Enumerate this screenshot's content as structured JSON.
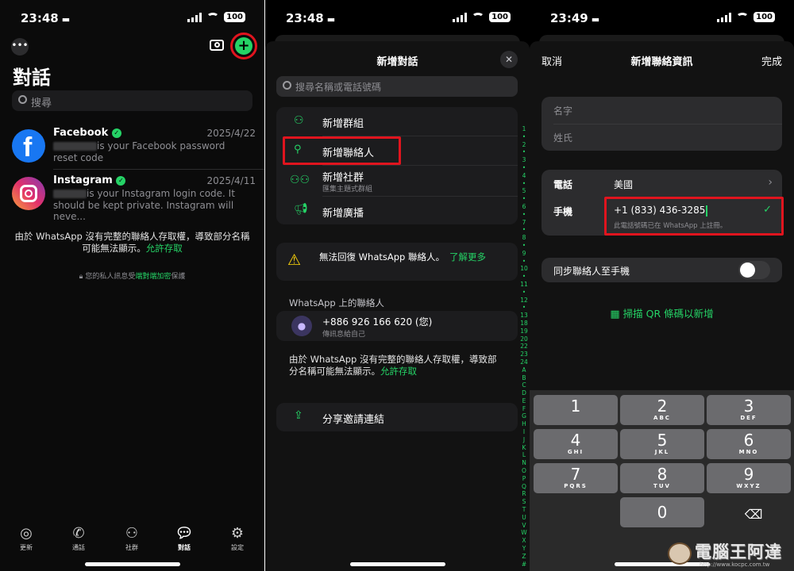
{
  "panel1": {
    "status": {
      "time": "23:48",
      "battery": "100"
    },
    "title": "對話",
    "search_placeholder": "搜尋",
    "chats": [
      {
        "name": "Facebook",
        "date": "2025/4/22",
        "line1": "is your Facebook password",
        "line2": "reset code"
      },
      {
        "name": "Instagram",
        "date": "2025/4/11",
        "line1": "is your Instagram login code. It",
        "line2": "should be kept private. Instagram will neve..."
      }
    ],
    "notice": "由於 WhatsApp 沒有完整的聯絡人存取權，導致部分名稱可能無法顯示。",
    "notice_link": "允許存取",
    "privacy_prefix": "您的私人訊息受",
    "privacy_link": "端對端加密",
    "privacy_suffix": "保護",
    "tabs": [
      "更新",
      "通話",
      "社群",
      "對話",
      "設定"
    ]
  },
  "panel2": {
    "status": {
      "time": "23:48",
      "battery": "100"
    },
    "title": "新增對話",
    "search_placeholder": "搜尋名稱或電話號碼",
    "menu": [
      {
        "label": "新增群組",
        "sub": ""
      },
      {
        "label": "新增聯絡人",
        "sub": ""
      },
      {
        "label": "新增社群",
        "sub": "匯集主題式群組"
      },
      {
        "label": "新增廣播",
        "sub": ""
      }
    ],
    "warning": "無法回復 WhatsApp 聯絡人。",
    "warning_link": "了解更多",
    "section_header": "WhatsApp 上的聯絡人",
    "self_contact": {
      "number": "+886 926 166 620 (您)",
      "sub": "傳訊息給自己"
    },
    "notice": "由於 WhatsApp 沒有完整的聯絡人存取權，導致部分名稱可能無法顯示。",
    "notice_link": "允許存取",
    "share": "分享邀請連結",
    "index": [
      "1",
      "2",
      "3",
      "4",
      "5",
      "6",
      "7",
      "8",
      "9",
      "10",
      "11",
      "12",
      "13",
      "18",
      "19",
      "20",
      "22",
      "23",
      "24",
      "A",
      "B",
      "C",
      "D",
      "E",
      "F",
      "G",
      "H",
      "I",
      "J",
      "K",
      "L",
      "N",
      "O",
      "P",
      "Q",
      "R",
      "S",
      "T",
      "U",
      "V",
      "W",
      "X",
      "Y",
      "Z",
      "#"
    ]
  },
  "panel3": {
    "status": {
      "time": "23:49",
      "battery": "100"
    },
    "cancel": "取消",
    "title": "新增聯絡資訊",
    "done": "完成",
    "first_name_placeholder": "名字",
    "last_name_placeholder": "姓氏",
    "phone_label": "電話",
    "country": "美國",
    "mobile_label": "手機",
    "mobile_value": "+1  (833) 436-3285",
    "mobile_note": "此電話號碼已在 WhatsApp 上註冊。",
    "sync_label": "同步聯絡人至手機",
    "scan_label": "掃描 QR 條碼以新增",
    "keys": [
      {
        "n": "1",
        "l": ""
      },
      {
        "n": "2",
        "l": "ABC"
      },
      {
        "n": "3",
        "l": "DEF"
      },
      {
        "n": "4",
        "l": "GHI"
      },
      {
        "n": "5",
        "l": "JKL"
      },
      {
        "n": "6",
        "l": "MNO"
      },
      {
        "n": "7",
        "l": "PQRS"
      },
      {
        "n": "8",
        "l": "TUV"
      },
      {
        "n": "9",
        "l": "WXYZ"
      },
      {
        "n": "0",
        "l": ""
      }
    ],
    "watermark": "電腦王阿達",
    "watermark_url": "http://www.kocpc.com.tw"
  }
}
